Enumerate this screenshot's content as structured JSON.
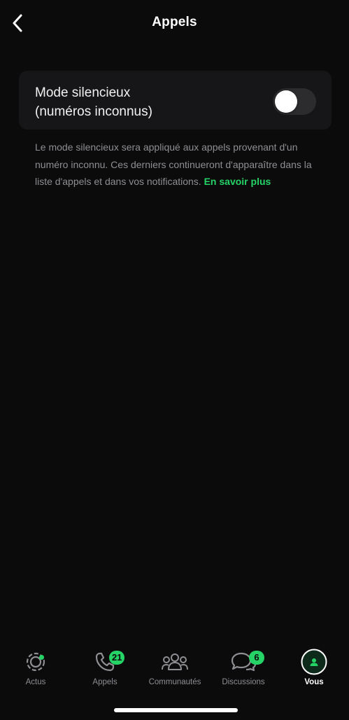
{
  "header": {
    "title": "Appels",
    "back_icon": "chevron-left-icon"
  },
  "silent_mode": {
    "label_line1": "Mode silencieux",
    "label_line2": "(numéros inconnus)",
    "enabled": false
  },
  "footnote": {
    "text": "Le mode silencieux sera appliqué aux appels provenant d'un numéro inconnu. Ces derniers continueront d'apparaître dans la liste d'appels et dans vos notifications. ",
    "link": "En savoir plus"
  },
  "tabs": [
    {
      "label": "Actus",
      "icon": "status-icon",
      "badge": null,
      "dot": true,
      "active": false
    },
    {
      "label": "Appels",
      "icon": "phone-icon",
      "badge": "21",
      "active": false
    },
    {
      "label": "Communautés",
      "icon": "communities-icon",
      "badge": null,
      "active": false
    },
    {
      "label": "Discussions",
      "icon": "chats-icon",
      "badge": "6",
      "active": false
    },
    {
      "label": "Vous",
      "icon": "profile-icon",
      "badge": null,
      "active": true
    }
  ],
  "colors": {
    "accent": "#25d366",
    "background": "#0b0b0c",
    "card": "#161618",
    "secondary_text": "#8e8e93"
  }
}
